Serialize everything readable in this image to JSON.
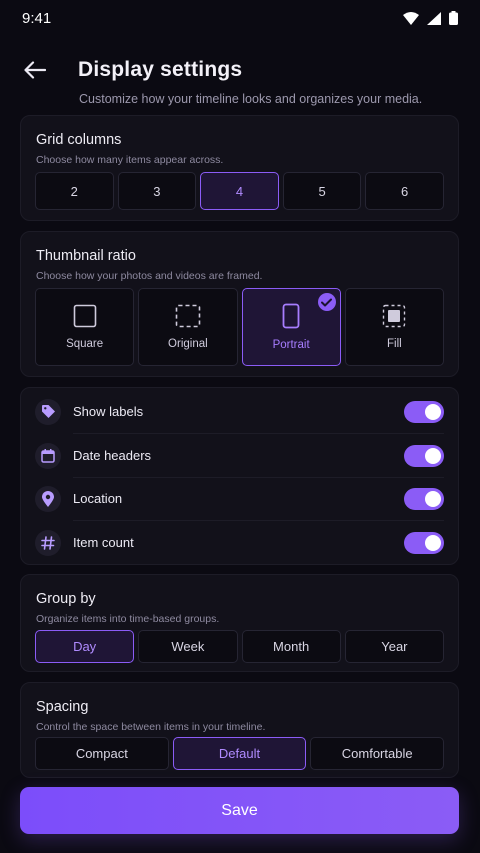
{
  "status_bar": {
    "time": "9:41"
  },
  "header": {
    "title": "Display settings",
    "subtitle": "Customize how your timeline looks and organizes your media."
  },
  "grid_columns": {
    "title": "Grid columns",
    "description": "Choose how many items appear across.",
    "options": [
      "2",
      "3",
      "4",
      "5",
      "6"
    ],
    "selected": "4"
  },
  "thumbnail_ratio": {
    "title": "Thumbnail ratio",
    "description": "Choose how your photos and videos are framed.",
    "options": [
      {
        "label": "Square",
        "icon": "square-icon"
      },
      {
        "label": "Original",
        "icon": "dashed-square-icon"
      },
      {
        "label": "Portrait",
        "icon": "portrait-icon"
      },
      {
        "label": "Fill",
        "icon": "fill-icon"
      }
    ],
    "selected": "Portrait"
  },
  "toggles": [
    {
      "label": "Show labels",
      "icon": "tag-icon",
      "on": true
    },
    {
      "label": "Date headers",
      "icon": "calendar-icon",
      "on": true
    },
    {
      "label": "Location",
      "icon": "location-pin-icon",
      "on": true
    },
    {
      "label": "Item count",
      "icon": "hash-icon",
      "on": true
    }
  ],
  "group_by": {
    "title": "Group by",
    "description": "Organize items into time-based groups.",
    "options": [
      "Day",
      "Week",
      "Month",
      "Year"
    ],
    "selected": "Day"
  },
  "spacing": {
    "title": "Spacing",
    "description": "Control the space between items in your timeline.",
    "options": [
      "Compact",
      "Default",
      "Comfortable"
    ],
    "selected": "Default"
  },
  "save_label": "Save",
  "colors": {
    "accent": "#8b5cf6",
    "background": "#0b0a12",
    "card": "#12111a"
  }
}
